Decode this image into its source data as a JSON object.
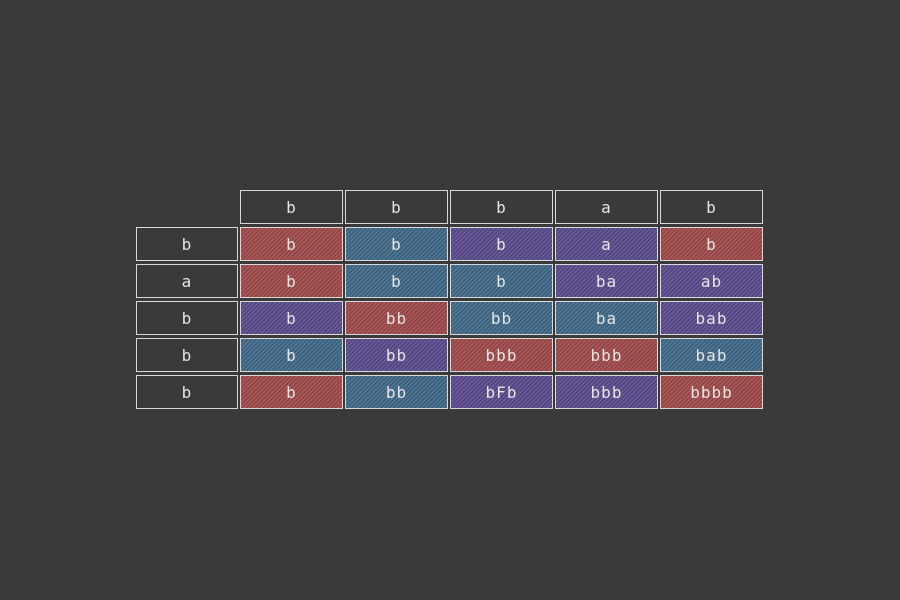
{
  "table": {
    "column_headers": [
      "b",
      "b",
      "b",
      "a",
      "b"
    ],
    "row_headers": [
      "b",
      "a",
      "b",
      "b",
      "b"
    ],
    "cells": [
      [
        "b",
        "b",
        "b",
        "a",
        "b"
      ],
      [
        "b",
        "b",
        "b",
        "ba",
        "ab"
      ],
      [
        "b",
        "bb",
        "bb",
        "ba",
        "bab"
      ],
      [
        "b",
        "bb",
        "bbb",
        "bbb",
        "bab"
      ],
      [
        "b",
        "bb",
        "bFb",
        "bbb",
        "bbbb"
      ]
    ],
    "cell_colors": [
      [
        "red",
        "blue",
        "purple",
        "purple",
        "red"
      ],
      [
        "red",
        "blue",
        "blue",
        "purple",
        "purple"
      ],
      [
        "purple",
        "red",
        "blue",
        "blue",
        "purple"
      ],
      [
        "blue",
        "purple",
        "red",
        "red",
        "blue"
      ],
      [
        "red",
        "blue",
        "purple",
        "purple",
        "red"
      ]
    ]
  },
  "colors": {
    "background": "#3a3a3a",
    "outline": "#d9d9d9",
    "red": "#a04848",
    "blue": "#3f6a8a",
    "purple": "#5a4b8e"
  }
}
